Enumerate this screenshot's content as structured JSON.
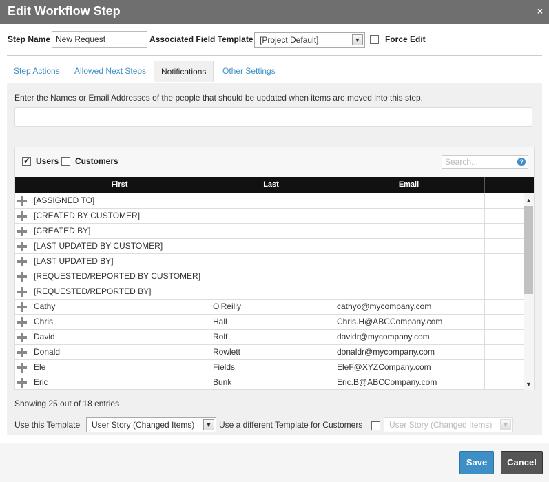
{
  "dialog": {
    "title": "Edit Workflow Step",
    "close_label": "×"
  },
  "step": {
    "name_label": "Step Name",
    "name_value": "New Request",
    "template_label": "Associated Field Template",
    "template_value": "[Project Default]",
    "force_edit_label": "Force Edit",
    "force_edit_checked": false
  },
  "tabs": [
    {
      "label": "Step Actions",
      "active": false
    },
    {
      "label": "Allowed Next Steps",
      "active": false
    },
    {
      "label": "Notifications",
      "active": true
    },
    {
      "label": "Other Settings",
      "active": false
    }
  ],
  "notifications": {
    "instruction": "Enter the Names or Email Addresses of the people that should be updated when items are moved into this step.",
    "email_input_value": ""
  },
  "filter": {
    "users_label": "Users",
    "users_checked": true,
    "customers_label": "Customers",
    "customers_checked": false,
    "search_placeholder": "Search...",
    "help_label": "?"
  },
  "table": {
    "columns": [
      "First",
      "Last",
      "Email"
    ],
    "rows": [
      {
        "first": "[ASSIGNED TO]",
        "last": "",
        "email": ""
      },
      {
        "first": "[CREATED BY CUSTOMER]",
        "last": "",
        "email": ""
      },
      {
        "first": "[CREATED BY]",
        "last": "",
        "email": ""
      },
      {
        "first": "[LAST UPDATED BY CUSTOMER]",
        "last": "",
        "email": ""
      },
      {
        "first": "[LAST UPDATED BY]",
        "last": "",
        "email": ""
      },
      {
        "first": "[REQUESTED/REPORTED BY CUSTOMER]",
        "last": "",
        "email": ""
      },
      {
        "first": "[REQUESTED/REPORTED BY]",
        "last": "",
        "email": ""
      },
      {
        "first": "Cathy",
        "last": "O'Reilly",
        "email": "cathyo@mycompany.com"
      },
      {
        "first": "Chris",
        "last": "Hall",
        "email": "Chris.H@ABCCompany.com"
      },
      {
        "first": "David",
        "last": "Rolf",
        "email": "davidr@mycompany.com"
      },
      {
        "first": "Donald",
        "last": "Rowlett",
        "email": "donaldr@mycompany.com"
      },
      {
        "first": "Ele",
        "last": "Fields",
        "email": "EleF@XYZCompany.com"
      },
      {
        "first": "Eric",
        "last": "Bunk",
        "email": "Eric.B@ABCCompany.com"
      }
    ],
    "showing_text": "Showing 25 out of 18 entries"
  },
  "template_row": {
    "use_template_label": "Use this Template",
    "template_value": "User Story (Changed Items)",
    "different_template_label": "Use a different Template for Customers",
    "different_template_checked": false,
    "customer_template_value": "User Story (Changed Items)"
  },
  "footer": {
    "save_label": "Save",
    "cancel_label": "Cancel"
  },
  "colors": {
    "accent": "#3d8fc6",
    "titlebar": "#6f6f6f",
    "header_bg": "#111111",
    "cancel_bg": "#555555"
  }
}
